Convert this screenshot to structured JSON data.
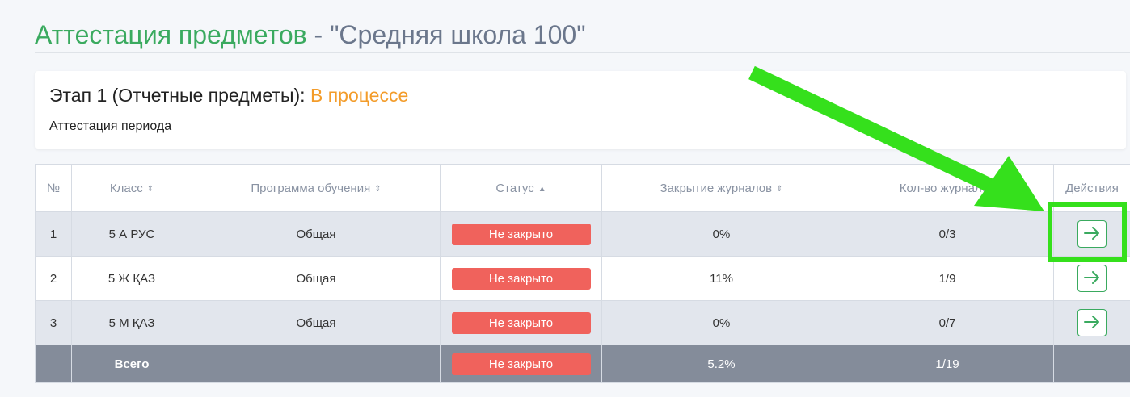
{
  "page": {
    "title_part1": "Аттестация предметов",
    "title_sep": " - ",
    "title_part2": "\"Средняя школа 100\""
  },
  "stage": {
    "title": "Этап 1 (Отчетные предметы): ",
    "status": "В процессе",
    "subtitle": "Аттестация периода"
  },
  "table": {
    "headers": {
      "num": "№",
      "class": "Класс",
      "program": "Программа обучения",
      "status": "Статус",
      "closing": "Закрытие журналов",
      "count": "Кол-во журналов",
      "actions": "Действия"
    },
    "rows": [
      {
        "num": "1",
        "class": "5 А РУС",
        "program": "Общая",
        "status": "Не закрыто",
        "closing": "0%",
        "count": "0/3"
      },
      {
        "num": "2",
        "class": "5 Ж ҚАЗ",
        "program": "Общая",
        "status": "Не закрыто",
        "closing": "11%",
        "count": "1/9"
      },
      {
        "num": "3",
        "class": "5 М ҚАЗ",
        "program": "Общая",
        "status": "Не закрыто",
        "closing": "0%",
        "count": "0/7"
      }
    ],
    "total": {
      "label": "Всего",
      "status": "Не закрыто",
      "closing": "5.2%",
      "count": "1/19"
    }
  },
  "icons": {
    "sort": "sort-icon",
    "sort_up": "sort-up-icon",
    "go": "arrow-right-icon"
  },
  "colors": {
    "accent_green": "#3aaa5f",
    "status_orange": "#f39c2a",
    "badge_red": "#f0625c",
    "annotation_green": "#35e01c"
  }
}
